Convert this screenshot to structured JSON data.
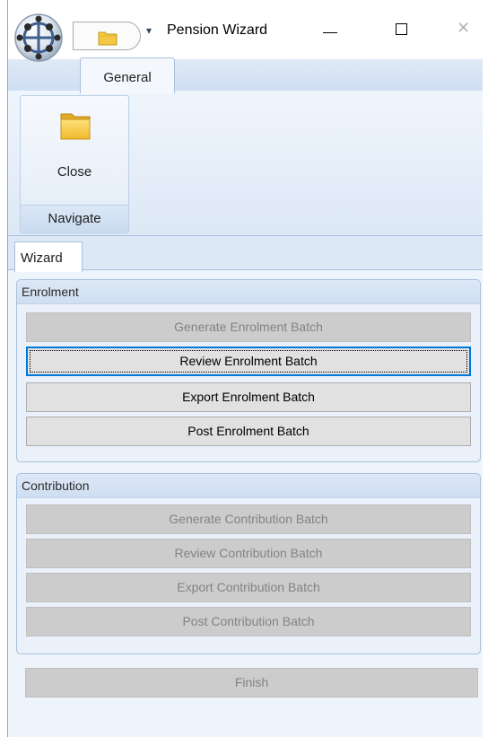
{
  "window": {
    "title": "Pension Wizard",
    "close_glyph": "✕",
    "qat_dropdown_glyph": "▾"
  },
  "ribbon": {
    "tabs": [
      {
        "label": "General",
        "active": true
      }
    ],
    "groups": [
      {
        "caption": "Navigate",
        "commands": [
          {
            "label": "Close",
            "icon": "folder-icon"
          }
        ]
      }
    ]
  },
  "document_tabs": [
    {
      "label": "Wizard",
      "active": true
    }
  ],
  "enrolment": {
    "title": "Enrolment",
    "buttons": [
      {
        "label": "Generate Enrolment Batch",
        "enabled": false
      },
      {
        "label": "Review Enrolment Batch",
        "enabled": true,
        "focused": true
      },
      {
        "label": "Export Enrolment Batch",
        "enabled": true
      },
      {
        "label": "Post Enrolment Batch",
        "enabled": true
      }
    ]
  },
  "contribution": {
    "title": "Contribution",
    "buttons": [
      {
        "label": "Generate Contribution Batch",
        "enabled": false
      },
      {
        "label": "Review Contribution Batch",
        "enabled": false
      },
      {
        "label": "Export Contribution Batch",
        "enabled": false
      },
      {
        "label": "Post Contribution Batch",
        "enabled": false
      }
    ]
  },
  "finish": {
    "label": "Finish",
    "enabled": false
  },
  "colors": {
    "ribbon": "#dfe9f6",
    "focus": "#0078d7",
    "disabled_text": "#838383",
    "folder": "#f4c842"
  }
}
